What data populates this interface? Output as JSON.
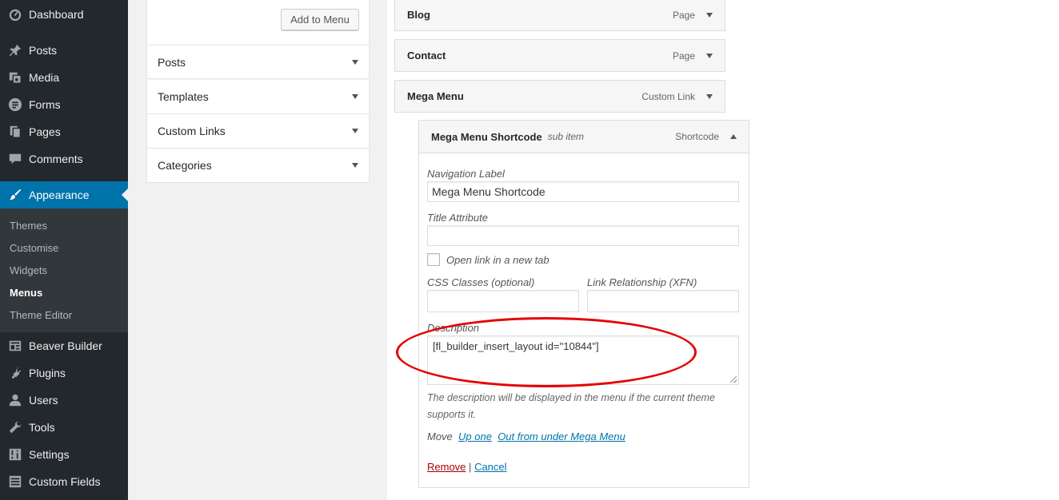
{
  "sidebar": {
    "items": [
      {
        "label": "Dashboard",
        "icon": "dashboard-icon"
      },
      {
        "label": "Posts",
        "icon": "pin-icon"
      },
      {
        "label": "Media",
        "icon": "media-icon"
      },
      {
        "label": "Forms",
        "icon": "forms-icon"
      },
      {
        "label": "Pages",
        "icon": "pages-icon"
      },
      {
        "label": "Comments",
        "icon": "comments-icon"
      },
      {
        "label": "Appearance",
        "icon": "paintbrush-icon"
      },
      {
        "label": "Beaver Builder",
        "icon": "layout-icon"
      },
      {
        "label": "Plugins",
        "icon": "plugin-icon"
      },
      {
        "label": "Users",
        "icon": "user-icon"
      },
      {
        "label": "Tools",
        "icon": "wrench-icon"
      },
      {
        "label": "Settings",
        "icon": "settings-icon"
      },
      {
        "label": "Custom Fields",
        "icon": "custom-fields-icon"
      }
    ],
    "submenu": [
      "Themes",
      "Customise",
      "Widgets",
      "Menus",
      "Theme Editor"
    ]
  },
  "left_panel": {
    "add_button": "Add to Menu",
    "sections": [
      "Posts",
      "Templates",
      "Custom Links",
      "Categories"
    ]
  },
  "menu_items": [
    {
      "title": "Blog",
      "type": "Page"
    },
    {
      "title": "Contact",
      "type": "Page"
    },
    {
      "title": "Mega Menu",
      "type": "Custom Link"
    }
  ],
  "expanded": {
    "title": "Mega Menu Shortcode",
    "sub_label": "sub item",
    "type": "Shortcode",
    "nav_label": "Navigation Label",
    "nav_value": "Mega Menu Shortcode",
    "title_attr_label": "Title Attribute",
    "title_attr_value": "",
    "new_tab_label": "Open link in a new tab",
    "css_label": "CSS Classes (optional)",
    "xfn_label": "Link Relationship (XFN)",
    "desc_label": "Description",
    "desc_value": "[fl_builder_insert_layout id=\"10844\"]",
    "desc_note": "The description will be displayed in the menu if the current theme supports it.",
    "move_label": "Move",
    "move_up": "Up one",
    "move_out": "Out from under Mega Menu",
    "remove": "Remove",
    "separator": "|",
    "cancel": "Cancel"
  },
  "colors": {
    "sidebar_bg": "#23282d",
    "accent": "#0073aa",
    "annotation": "#e50000"
  }
}
